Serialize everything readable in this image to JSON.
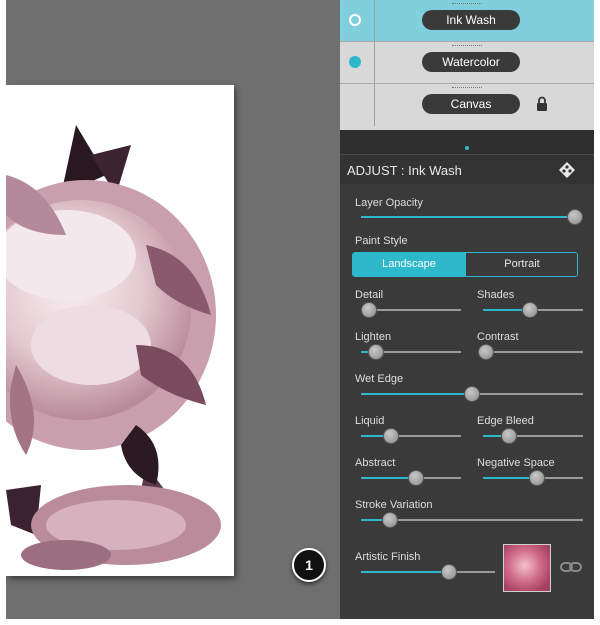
{
  "layers": [
    {
      "name": "Ink Wash",
      "visible_icon": "ring-dot-icon",
      "active": true
    },
    {
      "name": "Watercolor",
      "visible_icon": "filled-dot-icon",
      "active": false
    },
    {
      "name": "Canvas",
      "visible_icon": "",
      "active": false,
      "locked": true
    }
  ],
  "adjust": {
    "title": "ADJUST : Ink Wash",
    "layer_opacity": {
      "label": "Layer Opacity",
      "value": 1.0
    },
    "paint_style": {
      "label": "Paint Style",
      "options": [
        "Landscape",
        "Portrait"
      ],
      "selected": "Landscape"
    },
    "detail": {
      "label": "Detail",
      "value": 0.08
    },
    "shades": {
      "label": "Shades",
      "value": 0.47
    },
    "lighten": {
      "label": "Lighten",
      "value": 0.15
    },
    "contrast": {
      "label": "Contrast",
      "value": 0.03
    },
    "wet_edge": {
      "label": "Wet Edge",
      "value": 0.5
    },
    "liquid": {
      "label": "Liquid",
      "value": 0.3
    },
    "edge_bleed": {
      "label": "Edge Bleed",
      "value": 0.26
    },
    "abstract": {
      "label": "Abstract",
      "value": 0.55
    },
    "negative_space": {
      "label": "Negative Space",
      "value": 0.54
    },
    "stroke_variation": {
      "label": "Stroke Variation",
      "value": 0.13
    },
    "artistic_finish": {
      "label": "Artistic Finish",
      "value": 0.66
    }
  },
  "callout": {
    "number": "1"
  },
  "colors": {
    "accent": "#2eb8cc",
    "panel": "#3a3a3a",
    "active_layer": "#7fd0dc",
    "canvas_bg": "#6f6f6f"
  }
}
